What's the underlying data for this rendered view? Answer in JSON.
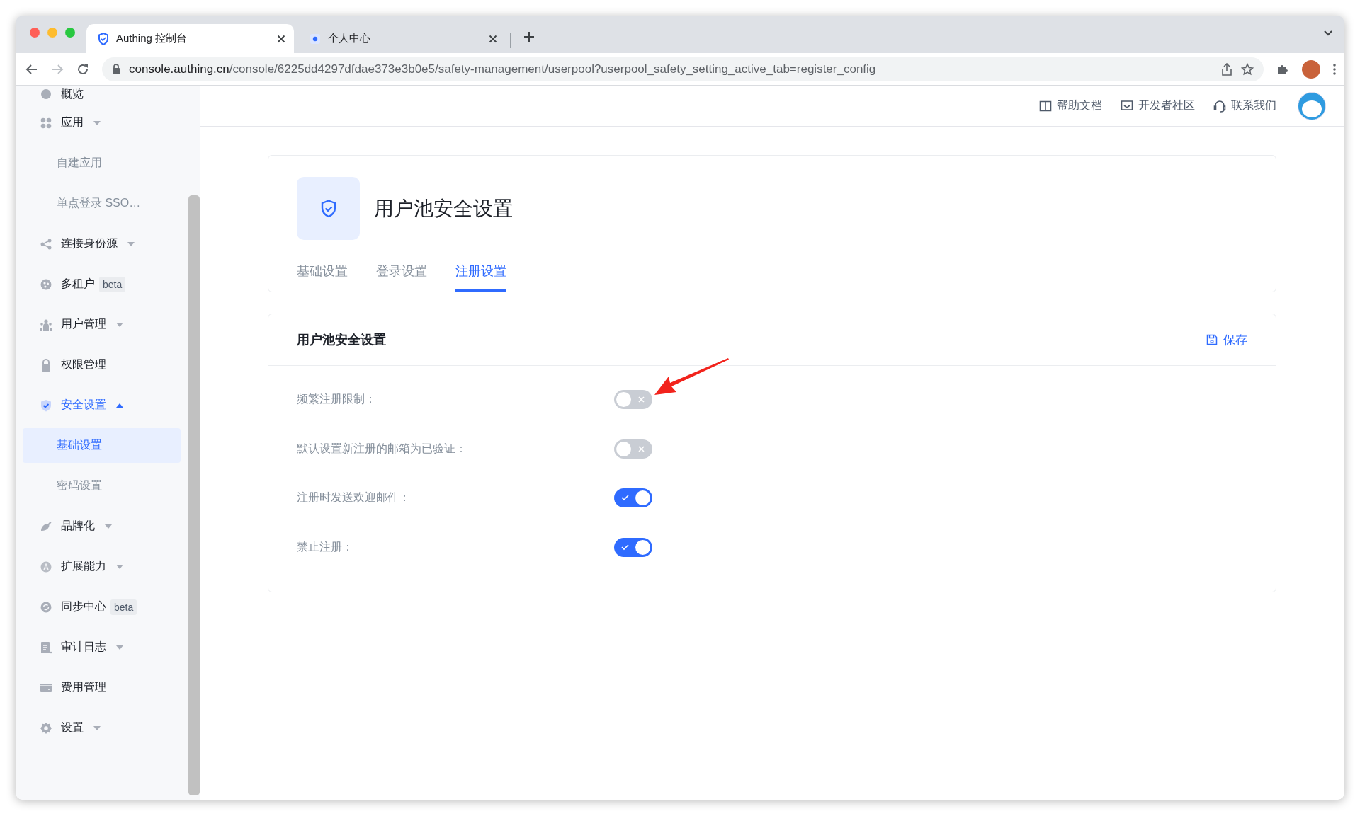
{
  "browser": {
    "tabs": [
      {
        "title": "Authing 控制台",
        "selected": true
      },
      {
        "title": "个人中心",
        "selected": false
      }
    ],
    "address": {
      "host": "console.authing.cn",
      "path": "/console/6225dd4297dfdae373e3b0e5/safety-management/userpool?userpool_safety_setting_active_tab=register_config"
    }
  },
  "sidebar": {
    "items": [
      {
        "label": "概览",
        "selected": false,
        "has_menu": false
      },
      {
        "label": "应用",
        "selected": false,
        "has_menu": true,
        "children": [
          {
            "label": "自建应用",
            "selected": false
          },
          {
            "label": "单点登录 SSO…",
            "selected": false
          }
        ]
      },
      {
        "label": "连接身份源",
        "selected": false,
        "has_menu": true
      },
      {
        "label": "多租户",
        "selected": false,
        "has_menu": false,
        "badge": "beta"
      },
      {
        "label": "用户管理",
        "selected": false,
        "has_menu": true
      },
      {
        "label": "权限管理",
        "selected": false,
        "has_menu": false
      },
      {
        "label": "安全设置",
        "selected": true,
        "has_menu": true,
        "children": [
          {
            "label": "基础设置",
            "selected": true
          },
          {
            "label": "密码设置",
            "selected": false
          }
        ]
      },
      {
        "label": "品牌化",
        "selected": false,
        "has_menu": true
      },
      {
        "label": "扩展能力",
        "selected": false,
        "has_menu": true
      },
      {
        "label": "同步中心",
        "selected": false,
        "has_menu": false,
        "badge": "beta"
      },
      {
        "label": "审计日志",
        "selected": false,
        "has_menu": true
      },
      {
        "label": "费用管理",
        "selected": false,
        "has_menu": false
      },
      {
        "label": "设置",
        "selected": false,
        "has_menu": true
      }
    ]
  },
  "header": {
    "links": [
      "帮助文档",
      "开发者社区",
      "联系我们"
    ]
  },
  "page": {
    "title": "用户池安全设置",
    "tabs": [
      {
        "label": "基础设置",
        "selected": false
      },
      {
        "label": "登录设置",
        "selected": false
      },
      {
        "label": "注册设置",
        "selected": true
      }
    ]
  },
  "settings": {
    "title": "用户池安全设置",
    "save": "保存",
    "rows": [
      {
        "label": "频繁注册限制：",
        "on": false
      },
      {
        "label": "默认设置新注册的邮箱为已验证：",
        "on": false
      },
      {
        "label": "注册时发送欢迎邮件：",
        "on": true
      },
      {
        "label": "禁止注册：",
        "on": true
      }
    ]
  }
}
